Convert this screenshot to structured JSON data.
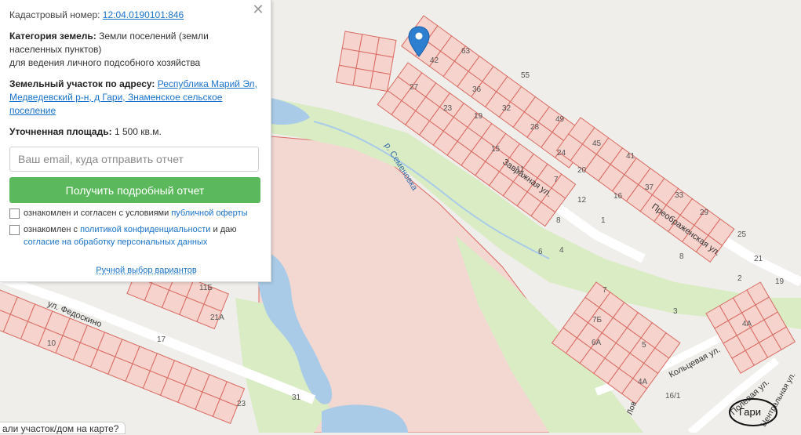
{
  "panel": {
    "cadastral_label": "Кадастровый номер:",
    "cadastral_number": "12:04.0190101:846",
    "category_label": "Категория земель:",
    "category_value": "Земли поселений (земли населенных пунктов)",
    "category_use": "для ведения личного подсобного хозяйства",
    "address_label": "Земельный участок по адресу:",
    "address_value": "Республика Марий Эл, Медведевский р-н, д Гари, Знаменское сельское поселение",
    "area_label": "Уточненная площадь:",
    "area_value": "1 500 кв.м.",
    "email_placeholder": "Ваш email, куда отправить отчет",
    "report_button": "Получить подробный отчет",
    "agree_terms_text": "ознакомлен и согласен с условиями",
    "agree_terms_link": "публичной оферты",
    "agree_privacy_text": "ознакомлен с",
    "agree_privacy_link": "политикой конфиденциальности",
    "agree_privacy_and": "и даю",
    "agree_privacy_consent": "согласие на обработку персональных данных",
    "manual_select": "Ручной выбор вариантов",
    "close_symbol": "✕"
  },
  "bottom_tab": {
    "label": "али участок/дом на карте?"
  },
  "map": {
    "colors": {
      "background": "#efeeea",
      "parcel_fill": "#f6d3cd",
      "parcel_stroke": "#d96b63",
      "water": "#a9cbe8",
      "green": "#d9ecc4",
      "big_field": "#f3d8d2"
    },
    "streets": {
      "zavrazhnaya": "Завражная ул.",
      "preobrazhenskaya": "Преображенская ул.",
      "fedoskino": "ул. Федоскино",
      "koltsevaya": "Кольцевая ул.",
      "polevaya": "Полевая ул.",
      "tsentralnaya": "Центральная ул.",
      "rover": "р. Семеновка",
      "lower": "Лов"
    },
    "village_label": "Гари",
    "house_numbers": {
      "n63": "63",
      "n42": "42",
      "n27": "27",
      "n36": "36",
      "n55": "55",
      "n23": "23",
      "n19": "19",
      "n32": "32",
      "n49": "49",
      "n28": "28",
      "n15": "15",
      "n24": "24",
      "n45": "45",
      "n41": "41",
      "n20": "20",
      "n11": "11",
      "n7": "7",
      "n37": "37",
      "n16": "16",
      "n12": "12",
      "n33": "33",
      "n29": "29",
      "n8": "8",
      "n1": "1",
      "n25": "25",
      "n6": "6",
      "n4": "4",
      "n21": "21",
      "n19b": "19",
      "n2": "2",
      "n7b": "7",
      "n8b": "8",
      "n7B": "7Б",
      "n4A": "4А",
      "n6A": "6А",
      "n5": "5",
      "n3": "3",
      "n4Ab": "4А",
      "n16_1": "16/1",
      "n10": "10",
      "n17": "17",
      "n21A": "21А",
      "n11B": "11Б",
      "n31": "31",
      "n23b": "23"
    }
  }
}
